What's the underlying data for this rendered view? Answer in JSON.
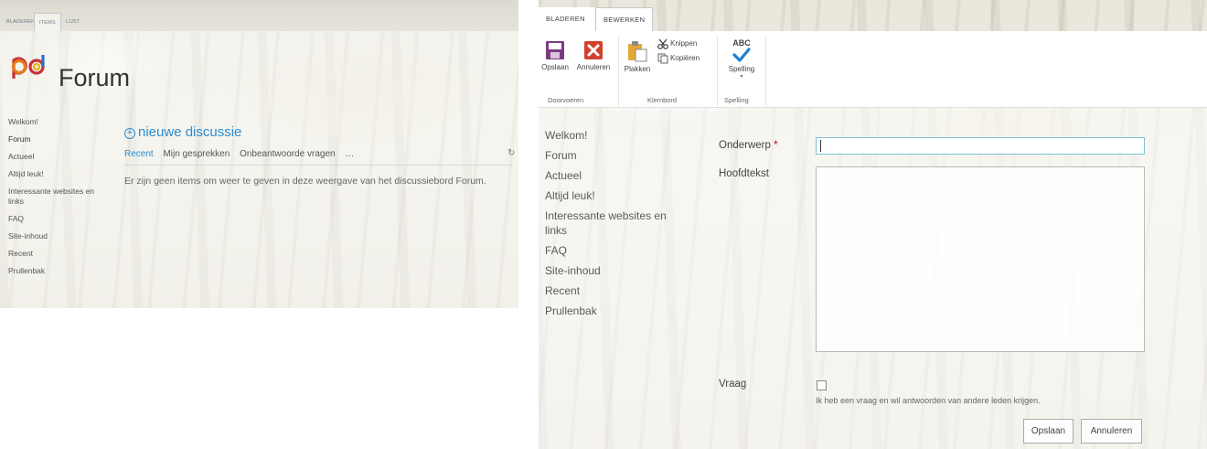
{
  "left_panel": {
    "tabs": [
      "BLADEREN",
      "ITEMS",
      "LIJST"
    ],
    "site_title": "Forum",
    "nav": [
      "Welkom!",
      "Forum",
      "Actueel",
      "Altijd leuk!",
      "Interessante websites en links",
      "FAQ",
      "Site-inhoud",
      "Recent",
      "Prullenbak"
    ],
    "selected_nav": "Forum",
    "new_discussion": "nieuwe discussie",
    "views": [
      "Recent",
      "Mijn gesprekken",
      "Onbeantwoorde vragen",
      "…"
    ],
    "empty_message": "Er zijn geen items om weer te geven in deze weergave van het discussiebord Forum."
  },
  "right_panel": {
    "tabs": [
      "BLADEREN",
      "BEWERKEN"
    ],
    "ribbon": {
      "save": "Opslaan",
      "cancel": "Annuleren",
      "paste": "Plakken",
      "cut": "Knippen",
      "copy": "Kopiëren",
      "spelling_icon_text": "ABC",
      "spelling": "Spelling",
      "groups": [
        "Doorvoeren",
        "Klembord",
        "Spelling"
      ]
    },
    "nav": [
      "Welkom!",
      "Forum",
      "Actueel",
      "Altijd leuk!",
      "Interessante websites en links",
      "FAQ",
      "Site-inhoud",
      "Recent",
      "Prullenbak"
    ],
    "form": {
      "subject_label": "Onderwerp",
      "required_marker": "*",
      "subject_value": "",
      "body_label": "Hoofdtekst",
      "question_label": "Vraag",
      "question_checked": false,
      "question_description": "Ik heb een vraag en wil antwoorden van andere leden krijgen.",
      "save_button": "Opslaan",
      "cancel_button": "Annuleren"
    }
  },
  "colors": {
    "accent": "#2a8dd4",
    "required": "#bf0000",
    "save_icon": "#7c3b82",
    "cancel_icon": "#d2402e",
    "spelling_check": "#1f7fcf"
  },
  "icons": [
    "logo-icon",
    "plus-circle-icon",
    "refresh-icon",
    "save-icon",
    "cancel-icon",
    "paste-icon",
    "scissors-icon",
    "copy-icon",
    "spelling-check-icon"
  ]
}
